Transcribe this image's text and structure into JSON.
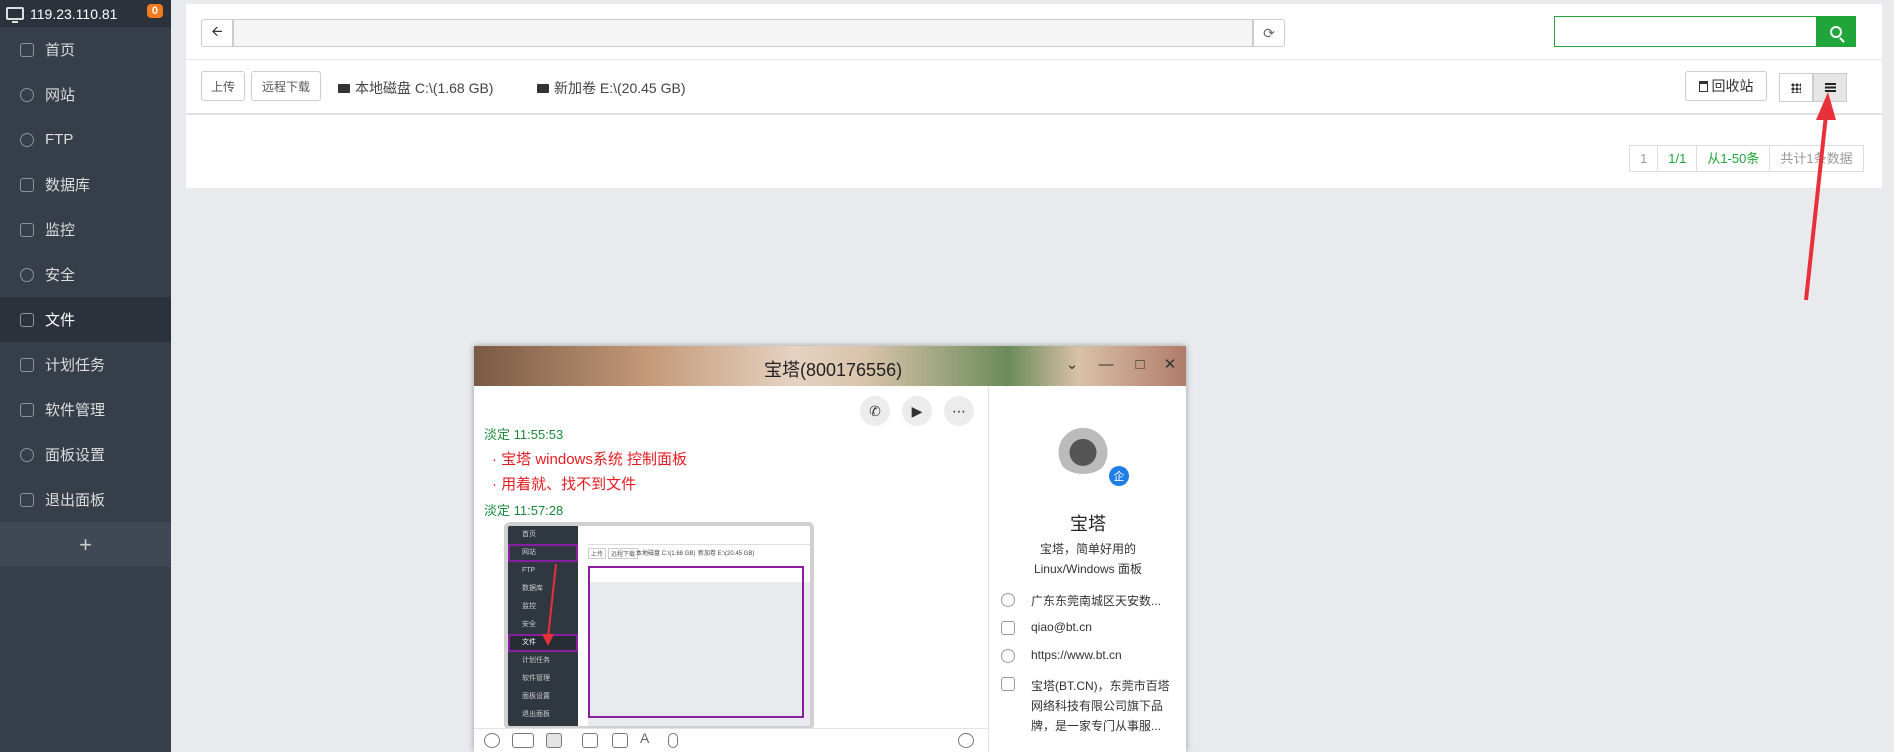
{
  "sidebar": {
    "host": "119.23.110.81",
    "badge": "0",
    "items": [
      {
        "label": "首页"
      },
      {
        "label": "网站"
      },
      {
        "label": "FTP"
      },
      {
        "label": "数据库"
      },
      {
        "label": "监控"
      },
      {
        "label": "安全"
      },
      {
        "label": "文件"
      },
      {
        "label": "计划任务"
      },
      {
        "label": "软件管理"
      },
      {
        "label": "面板设置"
      },
      {
        "label": "退出面板"
      }
    ],
    "add": "+"
  },
  "toolbar": {
    "path_value": "",
    "search_value": "",
    "upload": "上传",
    "remote_download": "远程下载",
    "disk_c": "本地磁盘 C:\\(1.68 GB)",
    "disk_e": "新加卷 E:\\(20.45 GB)",
    "recycle": "回收站"
  },
  "pager": {
    "page": "1",
    "pages": "1/1",
    "range": "从1-50条",
    "total": "共计1条数据"
  },
  "chat": {
    "title": "宝塔(800176556)",
    "msg1_sender": "淡定  11:55:53",
    "msg1_line1": "宝塔 windows系统  控制面板",
    "msg1_line2": "用着就、找不到文件",
    "msg2_sender": "淡定  11:57:28",
    "thumb": {
      "items": [
        "首页",
        "网站",
        "FTP",
        "数据库",
        "监控",
        "安全",
        "文件",
        "计划任务",
        "软件管理",
        "面板设置",
        "退出面板"
      ],
      "upload": "上传",
      "remote": "远程下载",
      "disk_c": "本地磁盘 C:\\(1.68 GB)",
      "disk_e": "新加卷 E:\\(20.45 GB)"
    },
    "profile": {
      "badge": "企",
      "name": "宝塔",
      "motto1": "宝塔，简单好用的",
      "motto2": "Linux/Windows 面板",
      "address": "广东东莞南城区天安数...",
      "email": "qiao@bt.cn",
      "website": "https://www.bt.cn",
      "desc1": "宝塔(BT.CN)，东莞市百塔",
      "desc2": "网络科技有限公司旗下品",
      "desc3": "牌，是一家专门从事服..."
    }
  },
  "colors": {
    "sidebar_bg": "#363e49",
    "accent_green": "#20a53a",
    "annotation_red": "#e8303a"
  }
}
